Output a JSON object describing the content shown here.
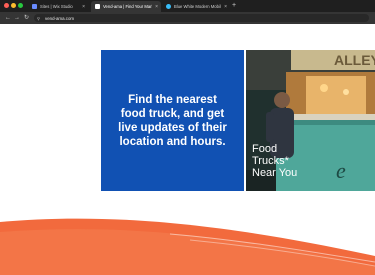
{
  "browser": {
    "tabs": [
      {
        "title": "Sites | Wix Studio",
        "favicon_color": "#6a8cff",
        "active": false
      },
      {
        "title": "Vend-ama | Find Your Market",
        "favicon_color": "#ffffff",
        "active": true
      },
      {
        "title": "Blue White Modern Mobile App",
        "favicon_color": "#38bdf8",
        "active": false
      }
    ],
    "close_glyph": "×",
    "new_tab_glyph": "+",
    "back_glyph": "←",
    "forward_glyph": "→",
    "reload_glyph": "↻",
    "url": "vend-ama.com"
  },
  "hero": {
    "headline": "Find the nearest food truck, and get live updates of their location and hours.",
    "photo_caption_lines": [
      "Food",
      "Trucks*",
      "Near You"
    ],
    "truck_sign_text": "ALLEY",
    "blue": "#1151b3"
  },
  "colors": {
    "accent_orange": "#f26a3d",
    "browser_dark": "#1f1f1f"
  }
}
